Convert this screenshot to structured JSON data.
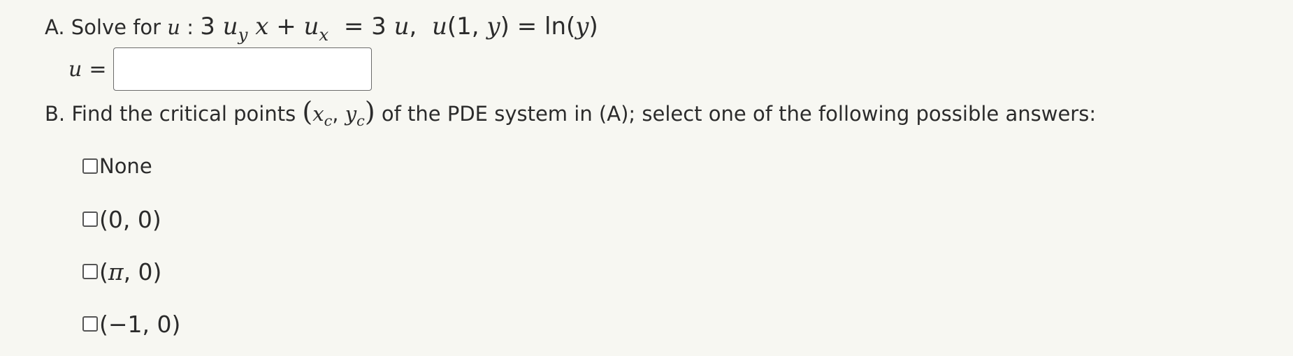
{
  "question_a": {
    "prefix": "A. Solve for",
    "var": "u",
    "colon": ":",
    "coef": "3",
    "u1": "u",
    "u1_sub": "y",
    "x": "x",
    "plus": "+",
    "u2": "u",
    "u2_sub": "x",
    "equals": "=",
    "rhs_coef": "3",
    "rhs_var": "u",
    "comma": ",",
    "ic_fn": "u",
    "ic_open": "(1,",
    "ic_y": "y",
    "ic_close": ")",
    "ic_equals": "=",
    "ic_ln": "ln(",
    "ic_ln_arg": "y",
    "ic_ln_close": ")"
  },
  "answer": {
    "label_var": "u",
    "label_eq": "=",
    "value": "",
    "placeholder": ""
  },
  "question_b": {
    "prefix": "B. Find the critical points",
    "open": "(",
    "xc": "x",
    "xc_sub": "c",
    "sep": ",",
    "yc": "y",
    "yc_sub": "c",
    "close": ")",
    "suffix": "of the PDE system in (A); select one of the following possible answers:"
  },
  "options": [
    {
      "label": "None"
    },
    {
      "label": "(0, 0)"
    },
    {
      "open": "(",
      "sym": "π",
      "rest": ", 0)"
    },
    {
      "label": "(−1, 0)"
    }
  ]
}
